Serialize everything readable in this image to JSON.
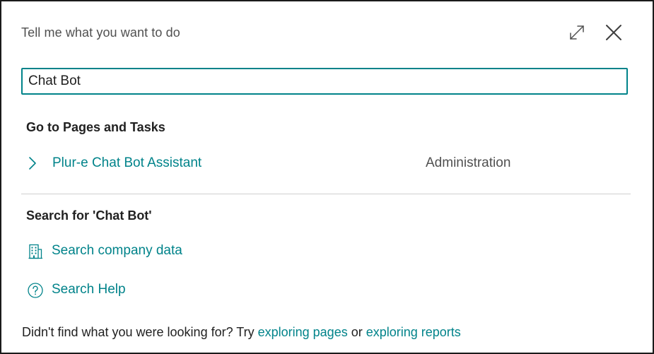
{
  "dialog": {
    "title": "Tell me what you want to do",
    "expand_icon": "expand-icon",
    "close_icon": "close-icon"
  },
  "search": {
    "value": "Chat Bot",
    "placeholder": ""
  },
  "pages_section": {
    "heading": "Go to Pages and Tasks",
    "results": [
      {
        "label": "Plur-e Chat Bot Assistant",
        "category": "Administration",
        "icon": "chevron-right-icon"
      }
    ]
  },
  "search_section": {
    "heading": "Search for 'Chat Bot'",
    "actions": [
      {
        "label": "Search company data",
        "icon": "building-icon"
      },
      {
        "label": "Search Help",
        "icon": "help-icon"
      }
    ]
  },
  "footer": {
    "prefix": "Didn't find what you were looking for? Try ",
    "link1": "exploring pages",
    "middle": " or ",
    "link2": "exploring reports"
  },
  "colors": {
    "accent": "#00838a",
    "text": "#212121",
    "muted": "#505050",
    "divider": "#d0d0d0"
  }
}
